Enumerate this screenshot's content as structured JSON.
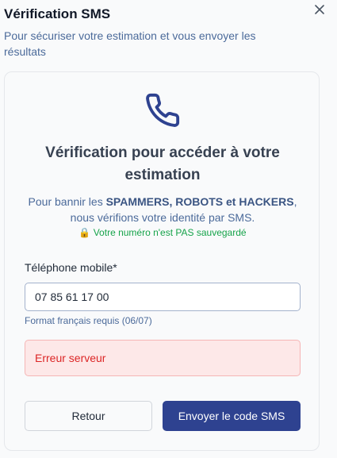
{
  "header": {
    "title": "Vérification SMS",
    "subtitle": "Pour sécuriser votre estimation et vous envoyer les résultats",
    "close_icon": "close-icon"
  },
  "card": {
    "icon": "phone-icon",
    "title": "Vérification pour accéder à votre estimation",
    "desc_prefix": "Pour bannir les ",
    "desc_bold": "SPAMMERS, ROBOTS et HACKERS",
    "desc_suffix": ", nous vérifions votre identité par SMS.",
    "notice_icon": "lock-icon",
    "notice_emoji": "🔒",
    "notice_text": "Votre numéro n'est PAS sauvegardé"
  },
  "form": {
    "phone_label": "Téléphone mobile*",
    "phone_value": "07 85 61 17 00",
    "phone_hint": "Format français requis (06/07)",
    "error_text": "Erreur serveur"
  },
  "actions": {
    "back_label": "Retour",
    "send_label": "Envoyer le code SMS"
  },
  "colors": {
    "primary": "#2e4290",
    "error_bg": "#fde8e8",
    "error_text": "#dc2626",
    "success_text": "#16a34a"
  }
}
